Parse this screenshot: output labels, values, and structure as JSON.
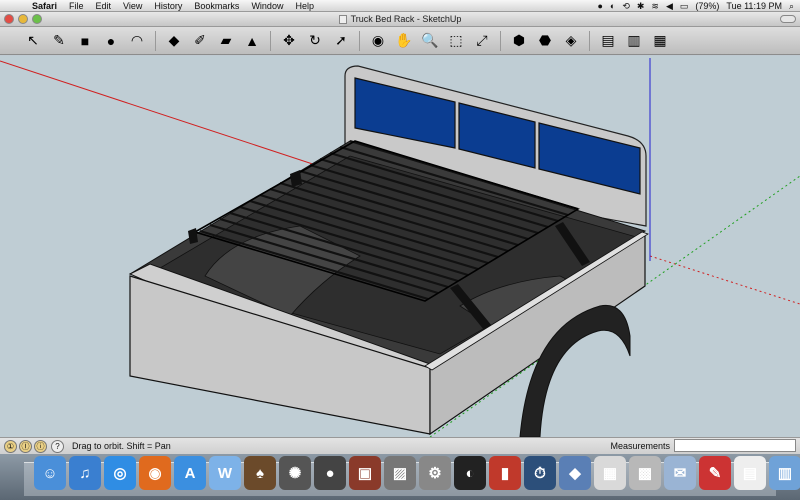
{
  "menubar": {
    "apple_glyph": "",
    "items": [
      {
        "label": "Safari"
      },
      {
        "label": "File"
      },
      {
        "label": "Edit"
      },
      {
        "label": "View"
      },
      {
        "label": "History"
      },
      {
        "label": "Bookmarks"
      },
      {
        "label": "Window"
      },
      {
        "label": "Help"
      }
    ],
    "battery": "(79%)",
    "clock": "Tue 11:19 PM"
  },
  "window": {
    "title": "Truck Bed Rack - SketchUp"
  },
  "toolbar": {
    "tools": [
      {
        "name": "select-tool",
        "glyph": "↖"
      },
      {
        "name": "pencil-tool",
        "glyph": "✎"
      },
      {
        "name": "rectangle-tool",
        "glyph": "■"
      },
      {
        "name": "circle-tool",
        "glyph": "●"
      },
      {
        "name": "arc-tool",
        "glyph": "◠"
      },
      {
        "name": "eraser-tool",
        "glyph": "◆"
      },
      {
        "name": "tape-measure-tool",
        "glyph": "✐"
      },
      {
        "name": "paint-bucket-tool",
        "glyph": "▰"
      },
      {
        "name": "push-pull-tool",
        "glyph": "▲"
      },
      {
        "name": "move-tool",
        "glyph": "✥"
      },
      {
        "name": "rotate-tool",
        "glyph": "↻"
      },
      {
        "name": "follow-me-tool",
        "glyph": "➚"
      },
      {
        "name": "orbit-tool",
        "glyph": "◉"
      },
      {
        "name": "pan-tool",
        "glyph": "✋"
      },
      {
        "name": "zoom-tool",
        "glyph": "🔍"
      },
      {
        "name": "zoom-window-tool",
        "glyph": "⬚"
      },
      {
        "name": "zoom-extents-tool",
        "glyph": "⤢"
      },
      {
        "name": "get-models-button",
        "glyph": "⬢"
      },
      {
        "name": "share-model-button",
        "glyph": "⬣"
      },
      {
        "name": "warehouse-button",
        "glyph": "◈"
      },
      {
        "name": "components-button",
        "glyph": "▤"
      },
      {
        "name": "materials-button",
        "glyph": "▥"
      },
      {
        "name": "styles-button",
        "glyph": "▦"
      }
    ]
  },
  "statusbar": {
    "hint": "Drag to orbit.  Shift = Pan",
    "measurements_label": "Measurements",
    "measurements_value": ""
  },
  "dock": {
    "apps": [
      {
        "name": "finder",
        "color": "#4a8fd9",
        "glyph": "☺"
      },
      {
        "name": "itunes",
        "color": "#3a7fd0",
        "glyph": "♫"
      },
      {
        "name": "safari",
        "color": "#2f8de4",
        "glyph": "◎"
      },
      {
        "name": "firefox",
        "color": "#e06a1e",
        "glyph": "◉"
      },
      {
        "name": "app-store",
        "color": "#3b8fe0",
        "glyph": "A"
      },
      {
        "name": "word-app",
        "color": "#7db2e8",
        "glyph": "W"
      },
      {
        "name": "solitaire",
        "color": "#6b4a2a",
        "glyph": "♠"
      },
      {
        "name": "bug-app",
        "color": "#555555",
        "glyph": "✺"
      },
      {
        "name": "facetime",
        "color": "#444444",
        "glyph": "●"
      },
      {
        "name": "photo-booth",
        "color": "#8a3a2a",
        "glyph": "▣"
      },
      {
        "name": "preview",
        "color": "#777777",
        "glyph": "▨"
      },
      {
        "name": "system-prefs",
        "color": "#888888",
        "glyph": "⚙"
      },
      {
        "name": "quicktime",
        "color": "#222222",
        "glyph": "◐"
      },
      {
        "name": "photo-booth-2",
        "color": "#c0392b",
        "glyph": "▮"
      },
      {
        "name": "time-machine",
        "color": "#2c4f7a",
        "glyph": "⏱"
      },
      {
        "name": "sketchup",
        "color": "#5a7fb5",
        "glyph": "◆"
      },
      {
        "name": "ical",
        "color": "#d9d9d9",
        "glyph": "▦"
      },
      {
        "name": "paint-can",
        "color": "#b8b8b8",
        "glyph": "▩"
      },
      {
        "name": "mail",
        "color": "#9ab4d4",
        "glyph": "✉"
      },
      {
        "name": "textedit",
        "color": "#cc3333",
        "glyph": "✎"
      },
      {
        "name": "document",
        "color": "#eeeeee",
        "glyph": "▤"
      },
      {
        "name": "applications-folder",
        "color": "#6fa2d8",
        "glyph": "▥"
      },
      {
        "name": "trash",
        "color": "#9aa4ae",
        "glyph": "🗑"
      }
    ]
  },
  "colors": {
    "canvas": "#bfcdd4",
    "truck_body": "#c8c8c8",
    "bed_dark": "#3a3a3a",
    "cab_window": "#0b3d91",
    "axis_red": "#d02020",
    "axis_green": "#20a020",
    "axis_blue": "#2020d0"
  }
}
